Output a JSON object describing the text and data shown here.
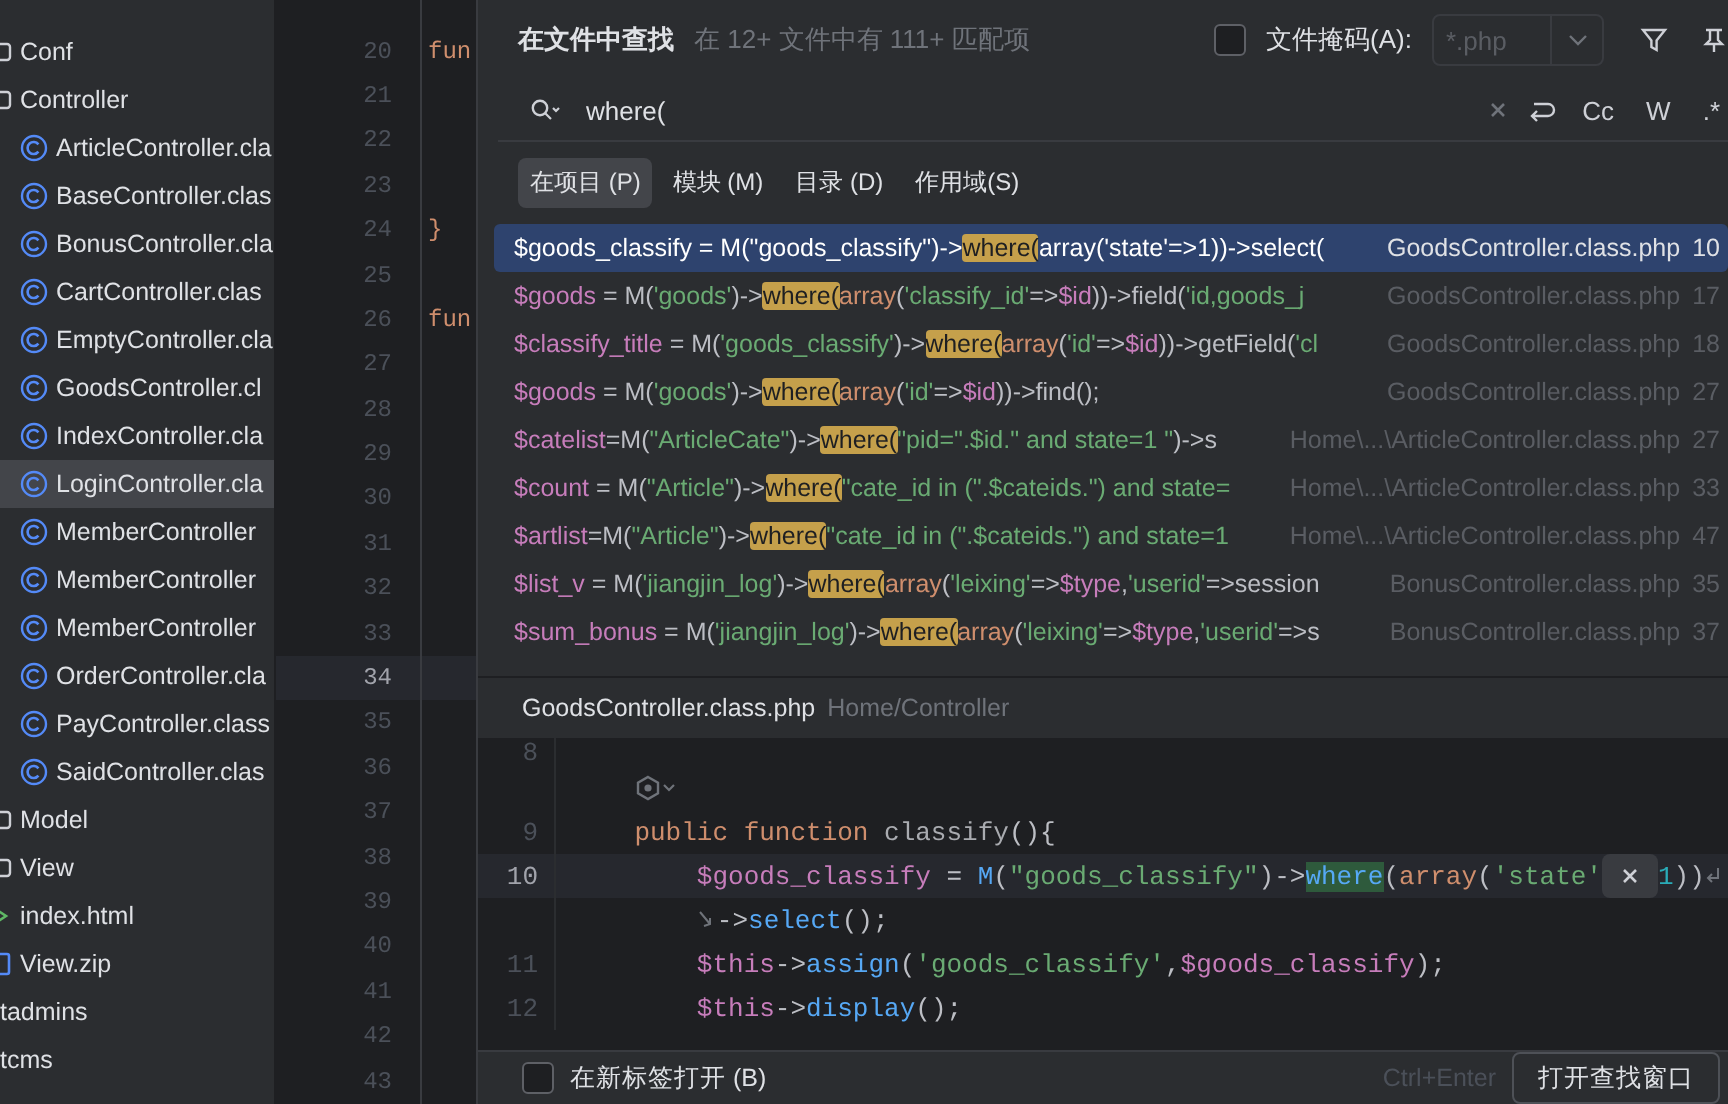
{
  "sidebar": {
    "items": [
      {
        "label": "Conf",
        "kind": "folder",
        "selected": false
      },
      {
        "label": "Controller",
        "kind": "folder",
        "selected": false,
        "children": [
          {
            "label": "ArticleController.cla",
            "kind": "class",
            "selected": false
          },
          {
            "label": "BaseController.clas",
            "kind": "class",
            "selected": false
          },
          {
            "label": "BonusController.cla",
            "kind": "class",
            "selected": false
          },
          {
            "label": "CartController.clas",
            "kind": "class",
            "selected": false
          },
          {
            "label": "EmptyController.cla",
            "kind": "class",
            "selected": false
          },
          {
            "label": "GoodsController.cl",
            "kind": "class",
            "selected": false
          },
          {
            "label": "IndexController.cla",
            "kind": "class",
            "selected": false
          },
          {
            "label": "LoginController.cla",
            "kind": "class",
            "selected": true
          },
          {
            "label": "MemberController",
            "kind": "class",
            "selected": false
          },
          {
            "label": "MemberController",
            "kind": "class",
            "selected": false
          },
          {
            "label": "MemberController",
            "kind": "class",
            "selected": false
          },
          {
            "label": "OrderController.cla",
            "kind": "class",
            "selected": false
          },
          {
            "label": "PayController.class",
            "kind": "class",
            "selected": false
          },
          {
            "label": "SaidController.clas",
            "kind": "class",
            "selected": false
          }
        ]
      },
      {
        "label": "Model",
        "kind": "folder",
        "selected": false
      },
      {
        "label": "View",
        "kind": "folder",
        "selected": false
      },
      {
        "label": "index.html",
        "kind": "html",
        "selected": false
      },
      {
        "label": "View.zip",
        "kind": "zip",
        "selected": false
      }
    ],
    "outer_items": [
      {
        "label": "tadmins",
        "selected": false
      },
      {
        "label": "tcms",
        "selected": false
      }
    ]
  },
  "editor": {
    "lines": [
      {
        "number": "20",
        "text": "fun",
        "current": false
      },
      {
        "number": "21",
        "current": false
      },
      {
        "number": "22",
        "current": false
      },
      {
        "number": "23",
        "current": false
      },
      {
        "number": "24",
        "text": "}",
        "current": false
      },
      {
        "number": "25",
        "current": false
      },
      {
        "number": "26",
        "text": "fun",
        "current": false
      },
      {
        "number": "27",
        "current": false
      },
      {
        "number": "28",
        "current": false
      },
      {
        "number": "29",
        "current": false
      },
      {
        "number": "30",
        "current": false
      },
      {
        "number": "31",
        "current": false
      },
      {
        "number": "32",
        "current": false
      },
      {
        "number": "33",
        "current": false
      },
      {
        "number": "34",
        "current": true
      },
      {
        "number": "35",
        "current": false
      },
      {
        "number": "36",
        "current": false
      },
      {
        "number": "37",
        "current": false
      },
      {
        "number": "38",
        "current": false
      },
      {
        "number": "39",
        "current": false
      },
      {
        "number": "40",
        "current": false
      },
      {
        "number": "41",
        "current": false
      },
      {
        "number": "42",
        "current": false
      },
      {
        "number": "43",
        "current": false
      }
    ]
  },
  "find_popup": {
    "title": "在文件中查找",
    "summary": "在 12+ 文件中有 111+ 匹配项",
    "file_mask": {
      "label": "文件掩码(A):",
      "checked": false,
      "value": "*.php"
    },
    "search": {
      "value": "where("
    },
    "options": [
      {
        "label": "Cc",
        "selected": false
      },
      {
        "label": "W",
        "selected": false
      },
      {
        "label": ".*",
        "selected": false
      }
    ],
    "scopes": [
      {
        "label": "在项目 (P)",
        "selected": true
      },
      {
        "label": "模块 (M)",
        "selected": false
      },
      {
        "label": "目录 (D)",
        "selected": false
      },
      {
        "label": "作用域(S)",
        "selected": false
      }
    ],
    "results": [
      {
        "selected": true,
        "file": "GoodsController.class.php",
        "line": "10",
        "tokens": [
          {
            "kind": "plain",
            "text": "$goods_classify = M(\"goods_classify\")->"
          },
          {
            "kind": "match",
            "text": "where("
          },
          {
            "kind": "plain",
            "text": "array('state'=>1))->select("
          }
        ]
      },
      {
        "selected": false,
        "file": "GoodsController.class.php",
        "line": "17",
        "tokens": [
          {
            "kind": "var",
            "text": "$goods"
          },
          {
            "kind": "plain",
            "text": " = M("
          },
          {
            "kind": "str",
            "text": "'goods'"
          },
          {
            "kind": "plain",
            "text": ")->"
          },
          {
            "kind": "match",
            "text": "where("
          },
          {
            "kind": "keyword",
            "text": "array"
          },
          {
            "kind": "plain",
            "text": "("
          },
          {
            "kind": "str",
            "text": "'classify_id'"
          },
          {
            "kind": "plain",
            "text": "=>"
          },
          {
            "kind": "var",
            "text": "$id"
          },
          {
            "kind": "plain",
            "text": "))->field("
          },
          {
            "kind": "str",
            "text": "'id,goods_j"
          }
        ]
      },
      {
        "selected": false,
        "file": "GoodsController.class.php",
        "line": "18",
        "tokens": [
          {
            "kind": "var",
            "text": "$classify_title"
          },
          {
            "kind": "plain",
            "text": " = M("
          },
          {
            "kind": "str",
            "text": "'goods_classify'"
          },
          {
            "kind": "plain",
            "text": ")->"
          },
          {
            "kind": "match",
            "text": "where("
          },
          {
            "kind": "keyword",
            "text": "array"
          },
          {
            "kind": "plain",
            "text": "("
          },
          {
            "kind": "str",
            "text": "'id'"
          },
          {
            "kind": "plain",
            "text": "=>"
          },
          {
            "kind": "var",
            "text": "$id"
          },
          {
            "kind": "plain",
            "text": "))->getField("
          },
          {
            "kind": "str",
            "text": "'cl"
          }
        ]
      },
      {
        "selected": false,
        "file": "GoodsController.class.php",
        "line": "27",
        "tokens": [
          {
            "kind": "var",
            "text": "$goods"
          },
          {
            "kind": "plain",
            "text": " = M("
          },
          {
            "kind": "str",
            "text": "'goods'"
          },
          {
            "kind": "plain",
            "text": ")->"
          },
          {
            "kind": "match",
            "text": "where("
          },
          {
            "kind": "keyword",
            "text": "array"
          },
          {
            "kind": "plain",
            "text": "("
          },
          {
            "kind": "str",
            "text": "'id'"
          },
          {
            "kind": "plain",
            "text": "=>"
          },
          {
            "kind": "var",
            "text": "$id"
          },
          {
            "kind": "plain",
            "text": "))->find();"
          }
        ]
      },
      {
        "selected": false,
        "file": "Home\\...\\ArticleController.class.php",
        "line": "27",
        "tokens": [
          {
            "kind": "var",
            "text": "$catelist"
          },
          {
            "kind": "plain",
            "text": "=M("
          },
          {
            "kind": "str",
            "text": "\"ArticleCate\""
          },
          {
            "kind": "plain",
            "text": ")->"
          },
          {
            "kind": "match",
            "text": "where("
          },
          {
            "kind": "str",
            "text": "\"pid=\".$id.\" and state=1 \""
          },
          {
            "kind": "plain",
            "text": ")->s"
          }
        ]
      },
      {
        "selected": false,
        "file": "Home\\...\\ArticleController.class.php",
        "line": "33",
        "tokens": [
          {
            "kind": "var",
            "text": "$count"
          },
          {
            "kind": "plain",
            "text": " = M("
          },
          {
            "kind": "str",
            "text": "\"Article\""
          },
          {
            "kind": "plain",
            "text": ")->"
          },
          {
            "kind": "match",
            "text": "where("
          },
          {
            "kind": "str",
            "text": "\"cate_id in (\".$cateids.\") and state="
          }
        ]
      },
      {
        "selected": false,
        "file": "Home\\...\\ArticleController.class.php",
        "line": "47",
        "tokens": [
          {
            "kind": "var",
            "text": "$artlist"
          },
          {
            "kind": "plain",
            "text": "=M("
          },
          {
            "kind": "str",
            "text": "\"Article\""
          },
          {
            "kind": "plain",
            "text": ")->"
          },
          {
            "kind": "match",
            "text": "where("
          },
          {
            "kind": "str",
            "text": "\"cate_id in (\".$cateids.\") and state=1"
          }
        ]
      },
      {
        "selected": false,
        "file": "BonusController.class.php",
        "line": "35",
        "tokens": [
          {
            "kind": "var",
            "text": "$list_v"
          },
          {
            "kind": "plain",
            "text": " = M("
          },
          {
            "kind": "str",
            "text": "'jiangjin_log'"
          },
          {
            "kind": "plain",
            "text": ")->"
          },
          {
            "kind": "match",
            "text": "where("
          },
          {
            "kind": "keyword",
            "text": "array"
          },
          {
            "kind": "plain",
            "text": "("
          },
          {
            "kind": "str",
            "text": "'leixing'"
          },
          {
            "kind": "plain",
            "text": "=>"
          },
          {
            "kind": "var",
            "text": "$type"
          },
          {
            "kind": "plain",
            "text": ","
          },
          {
            "kind": "str",
            "text": "'userid'"
          },
          {
            "kind": "plain",
            "text": "=>session"
          }
        ]
      },
      {
        "selected": false,
        "file": "BonusController.class.php",
        "line": "37",
        "tokens": [
          {
            "kind": "var",
            "text": "$sum_bonus"
          },
          {
            "kind": "plain",
            "text": " = M("
          },
          {
            "kind": "str",
            "text": "'jiangjin_log'"
          },
          {
            "kind": "plain",
            "text": ")->"
          },
          {
            "kind": "match",
            "text": "where("
          },
          {
            "kind": "keyword",
            "text": "array"
          },
          {
            "kind": "plain",
            "text": "("
          },
          {
            "kind": "str",
            "text": "'leixing'"
          },
          {
            "kind": "plain",
            "text": "=>"
          },
          {
            "kind": "var",
            "text": "$type"
          },
          {
            "kind": "plain",
            "text": ","
          },
          {
            "kind": "str",
            "text": "'userid'"
          },
          {
            "kind": "plain",
            "text": "=>s"
          }
        ]
      }
    ],
    "preview": {
      "file": "GoodsController.class.php",
      "path": "Home/Controller",
      "lines": [
        {
          "kind": "code",
          "number": "8",
          "current": false
        },
        {
          "kind": "hint",
          "current": false
        },
        {
          "kind": "code",
          "number": "9",
          "current": false,
          "tokens": [
            {
              "kind": "keyword",
              "text": "    public function "
            },
            {
              "kind": "name",
              "text": "classify"
            },
            {
              "kind": "plain",
              "text": "(){"
            }
          ]
        },
        {
          "kind": "code",
          "number": "10",
          "current": true,
          "tokens": [
            {
              "kind": "var",
              "text": "        $goods_classify"
            },
            {
              "kind": "plain",
              "text": " = "
            },
            {
              "kind": "call",
              "text": "M"
            },
            {
              "kind": "plain",
              "text": "("
            },
            {
              "kind": "str",
              "text": "\"goods_classify\""
            },
            {
              "kind": "plain",
              "text": ")->"
            },
            {
              "kind": "hit",
              "text": "where"
            },
            {
              "kind": "plain",
              "text": "("
            },
            {
              "kind": "keyword",
              "text": "array"
            },
            {
              "kind": "plain",
              "text": "("
            },
            {
              "kind": "str",
              "text": "'state'"
            }
          ],
          "tokens_after": [
            {
              "kind": "num",
              "text": "1"
            },
            {
              "kind": "plain",
              "text": "))"
            }
          ]
        },
        {
          "kind": "wrap",
          "current": false,
          "tokens": [
            {
              "kind": "plain",
              "text": "->"
            },
            {
              "kind": "call",
              "text": "select"
            },
            {
              "kind": "plain",
              "text": "();"
            }
          ]
        },
        {
          "kind": "code",
          "number": "11",
          "current": false,
          "tokens": [
            {
              "kind": "var",
              "text": "        $this"
            },
            {
              "kind": "plain",
              "text": "->"
            },
            {
              "kind": "call",
              "text": "assign"
            },
            {
              "kind": "plain",
              "text": "("
            },
            {
              "kind": "str",
              "text": "'goods_classify'"
            },
            {
              "kind": "plain",
              "text": ","
            },
            {
              "kind": "var",
              "text": "$goods_classify"
            },
            {
              "kind": "plain",
              "text": ");"
            }
          ]
        },
        {
          "kind": "code",
          "number": "12",
          "current": false,
          "tokens": [
            {
              "kind": "var",
              "text": "        $this"
            },
            {
              "kind": "plain",
              "text": "->"
            },
            {
              "kind": "call",
              "text": "display"
            },
            {
              "kind": "plain",
              "text": "();"
            }
          ]
        }
      ]
    },
    "open_in_new_tab": {
      "label": "在新标签打开 (B)",
      "checked": false
    },
    "shortcut": "Ctrl+Enter",
    "open_button": "打开查找窗口"
  }
}
